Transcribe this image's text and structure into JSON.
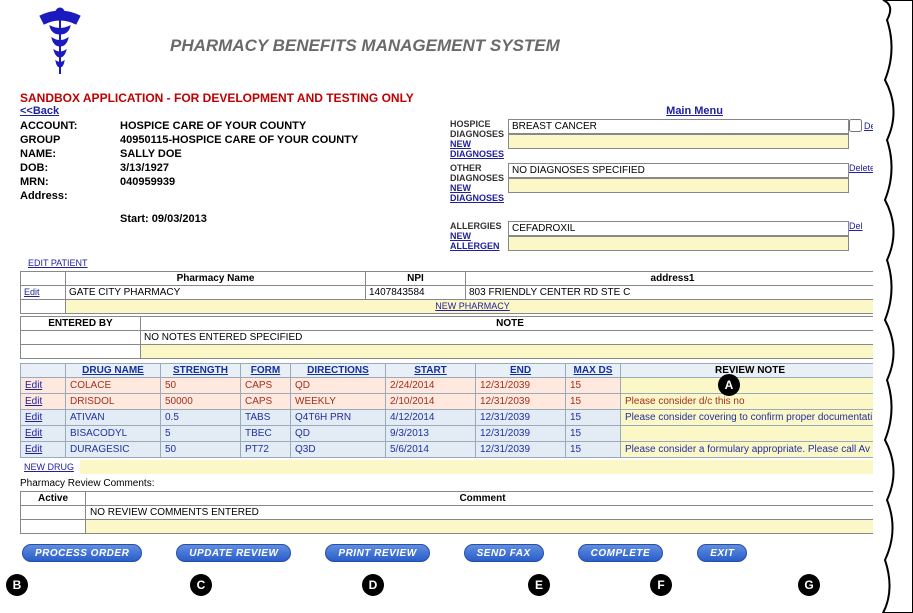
{
  "header": {
    "title": "PHARMACY BENEFITS MANAGEMENT SYSTEM"
  },
  "sandbox": "SANDBOX APPLICATION - FOR DEVELOPMENT AND TESTING ONLY",
  "nav": {
    "back": "<<Back",
    "mainmenu": "Main Menu"
  },
  "patient": {
    "account_l": "ACCOUNT:",
    "account": "HOSPICE CARE OF YOUR COUNTY",
    "group_l": "GROUP",
    "group": "40950115-HOSPICE CARE OF YOUR COUNTY",
    "name_l": "NAME:",
    "name": "SALLY   DOE",
    "dob_l": "DOB:",
    "dob": "3/13/1927",
    "mrn_l": "MRN:",
    "mrn": "040959939",
    "addr_l": "Address:",
    "addr": "",
    "start_l": "Start: 09/03/2013"
  },
  "dx": {
    "hospice_l": "HOSPICE DIAGNOSES",
    "hospice": "BREAST CANCER",
    "other_l": "OTHER DIAGNOSES",
    "other": "NO DIAGNOSES SPECIFIED",
    "allerg_l": "ALLERGIES",
    "allerg": "CEFADROXIL",
    "newdx": "NEW DIAGNOSES",
    "newal": "NEW ALLERGEN",
    "delete": "Delete",
    "del": "Del"
  },
  "editpatient": "EDIT PATIENT",
  "pharmacy": {
    "name_h": "Pharmacy Name",
    "npi_h": "NPI",
    "addr_h": "address1",
    "edit": "Edit",
    "name": "GATE CITY PHARMACY",
    "npi": "1407843584",
    "addr": "803 FRIENDLY CENTER RD STE C",
    "new": "NEW PHARMACY"
  },
  "notes": {
    "entered_h": "ENTERED BY",
    "note_h": "NOTE",
    "none": "NO NOTES ENTERED SPECIFIED"
  },
  "drugs": {
    "h": [
      "DRUG NAME",
      "STRENGTH",
      "FORM",
      "DIRECTIONS",
      "START",
      "END",
      "MAX DS",
      "REVIEW NOTE"
    ],
    "edit": "Edit",
    "newdrug": "NEW DRUG",
    "rows": [
      {
        "c": "r1",
        "d": "COLACE",
        "s": "50",
        "f": "CAPS",
        "dir": "QD",
        "st": "2/24/2014",
        "en": "12/31/2039",
        "mx": "15",
        "rn": ""
      },
      {
        "c": "r1",
        "d": "DRISDOL",
        "s": "50000",
        "f": "CAPS",
        "dir": "WEEKLY",
        "st": "2/10/2014",
        "en": "12/31/2039",
        "mx": "15",
        "rn": "Please consider d/c this no"
      },
      {
        "c": "r2",
        "d": "ATIVAN",
        "s": "0.5",
        "f": "TABS",
        "dir": "Q4T6H PRN",
        "st": "4/12/2014",
        "en": "12/31/2039",
        "mx": "15",
        "rn": "Please consider covering to confirm proper documentati"
      },
      {
        "c": "r2",
        "d": "BISACODYL",
        "s": "5",
        "f": "TBEC",
        "dir": "QD",
        "st": "9/3/2013",
        "en": "12/31/2039",
        "mx": "15",
        "rn": ""
      },
      {
        "c": "r2",
        "d": "DURAGESIC",
        "s": "50",
        "f": "PT72",
        "dir": "Q3D",
        "st": "5/6/2014",
        "en": "12/31/2039",
        "mx": "15",
        "rn": "Please consider a formulary appropriate. Please call Av"
      }
    ]
  },
  "comments": {
    "title": "Pharmacy Review Comments:",
    "active": "Active",
    "comment": "Comment",
    "none": "NO REVIEW COMMENTS ENTERED"
  },
  "buttons": {
    "process": "PROCESS ORDER",
    "update": "UPDATE REVIEW",
    "print": "PRINT REVIEW",
    "fax": "SEND FAX",
    "complete": "COMPLETE",
    "exit": "EXIT"
  },
  "callouts": [
    "A",
    "B",
    "C",
    "D",
    "E",
    "F",
    "G"
  ]
}
